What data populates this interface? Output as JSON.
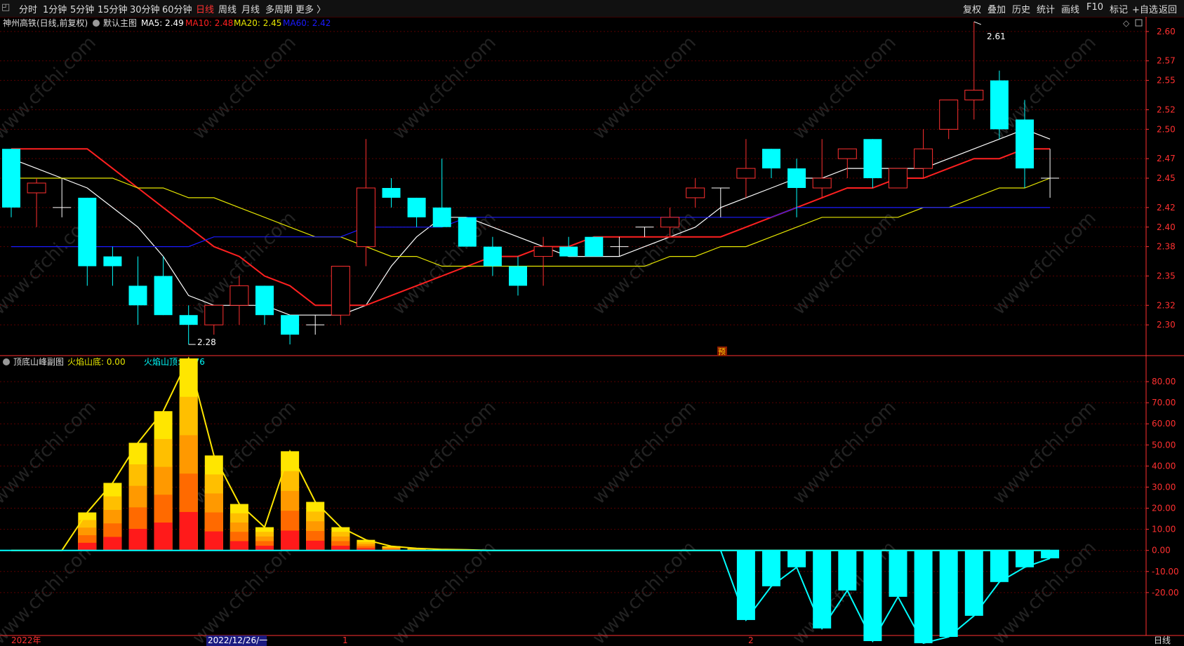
{
  "toolbar": {
    "left_items": [
      "分时",
      "1分钟",
      "5分钟",
      "15分钟",
      "30分钟",
      "60分钟",
      "日线",
      "周线",
      "月线",
      "多周期",
      "更多 〉"
    ],
    "selected": "日线",
    "right_items": [
      "复权",
      "叠加",
      "历史",
      "统计",
      "画线",
      "F10",
      "标记",
      "+自选",
      "返回"
    ]
  },
  "main_legend": {
    "stock": "神州高铁(日线,前复权)",
    "layout": "默认主图",
    "ma5": "MA5: 2.49",
    "ma10": "MA10: 2.48",
    "ma20": "MA20: 2.45",
    "ma60": "MA60: 2.42"
  },
  "sub_legend": {
    "title": "顶底山峰副图",
    "bottom": "火焰山底: 0.00",
    "top": "火焰山顶: -3.76"
  },
  "annotations": {
    "high": "2.61",
    "low": "2.28",
    "pre_mark": "预"
  },
  "bottom_axis": {
    "year": "2022年",
    "cursor_date": "2022/12/26/一",
    "m1": "1",
    "m2": "2",
    "period": "日线"
  },
  "watermark": "www.cfchi.com",
  "colors": {
    "up": "#ff3030",
    "down": "#00ffff",
    "ma5": "#ffffff",
    "ma10": "#ff2020",
    "ma20": "#e6e600",
    "ma60": "#1a1aff",
    "grid": "#5a0000",
    "axis": "#ff3030"
  },
  "chart_data": [
    {
      "type": "candlestick",
      "title": "神州高铁(日线,前复权)",
      "y_ticks": [
        2.6,
        2.57,
        2.55,
        2.52,
        2.5,
        2.47,
        2.45,
        2.42,
        2.4,
        2.38,
        2.35,
        2.32,
        2.3
      ],
      "y_tick_labels": [
        "2.60",
        "2.57",
        "2.55",
        "2.52",
        "2.50",
        "2.47",
        "2.45",
        "2.42",
        "2.40",
        "2.38",
        "2.35",
        "2.32",
        "2.30"
      ],
      "ylim": [
        2.27,
        2.615
      ],
      "candles": [
        [
          2.48,
          2.48,
          2.41,
          2.42
        ],
        [
          2.435,
          2.45,
          2.4,
          2.445
        ],
        [
          2.42,
          2.45,
          2.41,
          2.42
        ],
        [
          2.43,
          2.43,
          2.34,
          2.36
        ],
        [
          2.37,
          2.38,
          2.34,
          2.36
        ],
        [
          2.34,
          2.37,
          2.3,
          2.32
        ],
        [
          2.35,
          2.37,
          2.31,
          2.31
        ],
        [
          2.31,
          2.32,
          2.28,
          2.3
        ],
        [
          2.3,
          2.32,
          2.29,
          2.32
        ],
        [
          2.32,
          2.35,
          2.3,
          2.34
        ],
        [
          2.34,
          2.34,
          2.3,
          2.31
        ],
        [
          2.31,
          2.31,
          2.28,
          2.29
        ],
        [
          2.3,
          2.31,
          2.29,
          2.3
        ],
        [
          2.31,
          2.36,
          2.3,
          2.36
        ],
        [
          2.38,
          2.49,
          2.36,
          2.44
        ],
        [
          2.44,
          2.45,
          2.42,
          2.43
        ],
        [
          2.43,
          2.43,
          2.4,
          2.41
        ],
        [
          2.42,
          2.47,
          2.4,
          2.4
        ],
        [
          2.41,
          2.41,
          2.38,
          2.38
        ],
        [
          2.38,
          2.39,
          2.35,
          2.36
        ],
        [
          2.36,
          2.37,
          2.33,
          2.34
        ],
        [
          2.37,
          2.39,
          2.34,
          2.38
        ],
        [
          2.38,
          2.39,
          2.37,
          2.37
        ],
        [
          2.39,
          2.39,
          2.37,
          2.37
        ],
        [
          2.38,
          2.39,
          2.37,
          2.38
        ],
        [
          2.4,
          2.4,
          2.39,
          2.4
        ],
        [
          2.4,
          2.42,
          2.39,
          2.41
        ],
        [
          2.43,
          2.45,
          2.42,
          2.44
        ],
        [
          2.44,
          2.44,
          2.41,
          2.44
        ],
        [
          2.45,
          2.49,
          2.43,
          2.46
        ],
        [
          2.48,
          2.48,
          2.45,
          2.46
        ],
        [
          2.46,
          2.47,
          2.41,
          2.44
        ],
        [
          2.44,
          2.49,
          2.43,
          2.45
        ],
        [
          2.47,
          2.48,
          2.45,
          2.48
        ],
        [
          2.49,
          2.49,
          2.44,
          2.45
        ],
        [
          2.44,
          2.46,
          2.44,
          2.46
        ],
        [
          2.46,
          2.5,
          2.45,
          2.48
        ],
        [
          2.5,
          2.53,
          2.49,
          2.53
        ],
        [
          2.53,
          2.61,
          2.51,
          2.54
        ],
        [
          2.55,
          2.56,
          2.49,
          2.5
        ],
        [
          2.51,
          2.53,
          2.44,
          2.46
        ],
        [
          2.45,
          2.48,
          2.43,
          2.45
        ]
      ],
      "series": [
        {
          "name": "MA5",
          "values": [
            2.47,
            2.46,
            2.45,
            2.44,
            2.42,
            2.4,
            2.37,
            2.33,
            2.32,
            2.32,
            2.32,
            2.31,
            2.31,
            2.31,
            2.32,
            2.36,
            2.39,
            2.41,
            2.41,
            2.4,
            2.39,
            2.38,
            2.37,
            2.37,
            2.37,
            2.38,
            2.39,
            2.4,
            2.42,
            2.43,
            2.44,
            2.45,
            2.45,
            2.46,
            2.46,
            2.46,
            2.46,
            2.47,
            2.48,
            2.49,
            2.5,
            2.49
          ]
        },
        {
          "name": "MA10",
          "values": [
            2.48,
            2.48,
            2.48,
            2.48,
            2.46,
            2.44,
            2.42,
            2.4,
            2.38,
            2.37,
            2.35,
            2.34,
            2.32,
            2.32,
            2.32,
            2.33,
            2.34,
            2.35,
            2.36,
            2.37,
            2.37,
            2.38,
            2.38,
            2.39,
            2.39,
            2.39,
            2.39,
            2.39,
            2.39,
            2.4,
            2.41,
            2.42,
            2.43,
            2.44,
            2.44,
            2.45,
            2.45,
            2.46,
            2.47,
            2.47,
            2.48,
            2.48
          ]
        },
        {
          "name": "MA20",
          "values": [
            2.45,
            2.45,
            2.45,
            2.45,
            2.45,
            2.44,
            2.44,
            2.43,
            2.43,
            2.42,
            2.41,
            2.4,
            2.39,
            2.39,
            2.38,
            2.37,
            2.37,
            2.36,
            2.36,
            2.36,
            2.36,
            2.36,
            2.36,
            2.36,
            2.36,
            2.36,
            2.37,
            2.37,
            2.38,
            2.38,
            2.39,
            2.4,
            2.41,
            2.41,
            2.41,
            2.41,
            2.42,
            2.42,
            2.43,
            2.44,
            2.44,
            2.45
          ]
        },
        {
          "name": "MA60",
          "values": [
            2.38,
            2.38,
            2.38,
            2.38,
            2.38,
            2.38,
            2.38,
            2.38,
            2.39,
            2.39,
            2.39,
            2.39,
            2.39,
            2.39,
            2.4,
            2.4,
            2.4,
            2.4,
            2.41,
            2.41,
            2.41,
            2.41,
            2.41,
            2.41,
            2.41,
            2.41,
            2.41,
            2.41,
            2.41,
            2.41,
            2.41,
            2.42,
            2.42,
            2.42,
            2.42,
            2.42,
            2.42,
            2.42,
            2.42,
            2.42,
            2.42,
            2.42
          ]
        }
      ]
    },
    {
      "type": "bar",
      "title": "顶底山峰副图",
      "y_ticks": [
        80,
        70,
        60,
        50,
        40,
        30,
        20,
        10,
        0,
        -10,
        -20
      ],
      "y_tick_labels": [
        "80.00",
        "70.00",
        "60.00",
        "50.00",
        "40.00",
        "30.00",
        "20.00",
        "10.00",
        "0.00",
        "-10.00",
        "-20.00"
      ],
      "ylim": [
        -40,
        92
      ],
      "bottom_series": {
        "name": "火焰山底",
        "values": [
          0,
          0,
          0,
          18,
          32,
          51,
          66,
          91,
          45,
          22,
          11,
          47,
          23,
          11,
          5,
          2,
          1,
          0.5,
          0.3,
          0,
          0,
          0,
          0,
          0,
          0,
          0,
          0,
          0,
          0,
          0,
          0,
          0,
          0,
          0,
          0,
          0,
          0,
          0,
          0,
          0,
          0,
          0
        ]
      },
      "top_series": {
        "name": "火焰山顶",
        "values": [
          0,
          0,
          0,
          0,
          0,
          0,
          0,
          0,
          0,
          0,
          0,
          0,
          0,
          0,
          0,
          0,
          0,
          0,
          0,
          0,
          0,
          0,
          0,
          0,
          0,
          0,
          0,
          0,
          0,
          -33,
          -17,
          -8,
          -37,
          -19,
          -43,
          -22,
          -44,
          -41,
          -31,
          -15,
          -8,
          -3.76
        ]
      }
    }
  ]
}
